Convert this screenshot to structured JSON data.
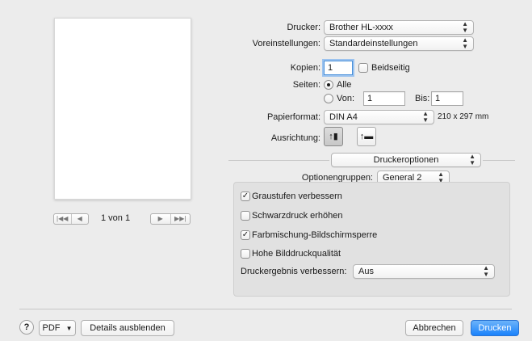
{
  "printer": {
    "label": "Drucker:",
    "value": "Brother HL-xxxx"
  },
  "presets": {
    "label": "Voreinstellungen:",
    "value": "Standardeinstellungen"
  },
  "copies": {
    "label": "Kopien:",
    "value": "1",
    "duplex_label": "Beidseitig",
    "duplex_checked": false
  },
  "pages": {
    "label": "Seiten:",
    "all_label": "Alle",
    "range_label": "Von:",
    "from_value": "1",
    "to_label": "Bis:",
    "to_value": "1",
    "selected": "all"
  },
  "paper": {
    "label": "Papierformat:",
    "value": "DIN A4",
    "size_text": "210 x 297 mm"
  },
  "orientation": {
    "label": "Ausrichtung:",
    "portrait_icon": "portrait-orientation-icon",
    "landscape_icon": "landscape-orientation-icon",
    "selected": "portrait"
  },
  "panel_select": {
    "value": "Druckeroptionen"
  },
  "option_groups": {
    "label": "Optionengruppen:",
    "value": "General 2"
  },
  "options": {
    "grayscale": {
      "label": "Graustufen verbessern",
      "checked": true
    },
    "black_print": {
      "label": "Schwarzdruck erhöhen",
      "checked": false
    },
    "color_lock": {
      "label": "Farbmischung-Bildschirmsperre",
      "checked": true
    },
    "high_quality": {
      "label": "Hohe Bilddruckqualität",
      "checked": false
    },
    "improve_output": {
      "label": "Druckergebnis verbessern:",
      "value": "Aus"
    }
  },
  "preview_nav": {
    "page_text": "1 von 1"
  },
  "footer": {
    "help": "?",
    "pdf": "PDF",
    "details": "Details ausblenden",
    "cancel": "Abbrechen",
    "print": "Drucken"
  },
  "colors": {
    "accent": "#1a82fb",
    "background": "#ececec"
  }
}
